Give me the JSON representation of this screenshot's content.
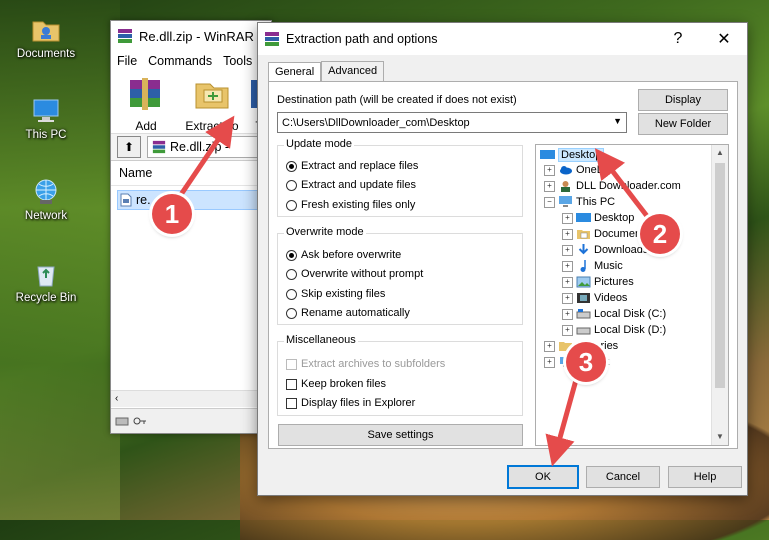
{
  "desktop": {
    "icons": [
      {
        "label": "Documents",
        "icon": "documents-folder-icon"
      },
      {
        "label": "This PC",
        "icon": "this-pc-icon"
      },
      {
        "label": "Network",
        "icon": "network-icon"
      },
      {
        "label": "Recycle Bin",
        "icon": "recycle-bin-icon"
      }
    ]
  },
  "winrar": {
    "title": "Re.dll.zip - WinRAR",
    "menu": [
      "File",
      "Commands",
      "Tools"
    ],
    "toolbar": {
      "add": "Add",
      "extract_to": "Extract To",
      "test": "T"
    },
    "path": "Re.dll.zip -",
    "column_name": "Name",
    "file": "re."
  },
  "dialog": {
    "title": "Extraction path and options",
    "help": "?",
    "close": "✕",
    "tabs": {
      "general": "General",
      "advanced": "Advanced"
    },
    "dest_label": "Destination path (will be created if does not exist)",
    "dest_value": "C:\\Users\\DllDownloader_com\\Desktop",
    "display_btn": "Display",
    "new_folder_btn": "New Folder",
    "update_mode": {
      "title": "Update mode",
      "options": [
        "Extract and replace files",
        "Extract and update files",
        "Fresh existing files only"
      ],
      "selected": 0
    },
    "overwrite_mode": {
      "title": "Overwrite mode",
      "options": [
        "Ask before overwrite",
        "Overwrite without prompt",
        "Skip existing files",
        "Rename automatically"
      ],
      "selected": 0
    },
    "misc": {
      "title": "Miscellaneous",
      "options": [
        "Extract archives to subfolders",
        "Keep broken files",
        "Display files in Explorer"
      ]
    },
    "save_settings": "Save settings",
    "tree": [
      {
        "label": "Desktop",
        "level": 0,
        "selected": true
      },
      {
        "label": "OneDri",
        "level": 1
      },
      {
        "label": "DLL Downloader.com",
        "level": 1
      },
      {
        "label": "This PC",
        "level": 1
      },
      {
        "label": "Desktop",
        "level": 2
      },
      {
        "label": "Documents",
        "level": 2
      },
      {
        "label": "Downloads",
        "level": 2
      },
      {
        "label": "Music",
        "level": 2
      },
      {
        "label": "Pictures",
        "level": 2
      },
      {
        "label": "Videos",
        "level": 2
      },
      {
        "label": "Local Disk (C:)",
        "level": 2
      },
      {
        "label": "Local Disk (D:)",
        "level": 2
      },
      {
        "label": "Libraries",
        "level": 1
      },
      {
        "label": "k",
        "level": 1
      }
    ],
    "ok": "OK",
    "cancel": "Cancel",
    "help_btn": "Help"
  },
  "annotations": {
    "one": "1",
    "two": "2",
    "three": "3",
    "color": "#e54b4b"
  }
}
